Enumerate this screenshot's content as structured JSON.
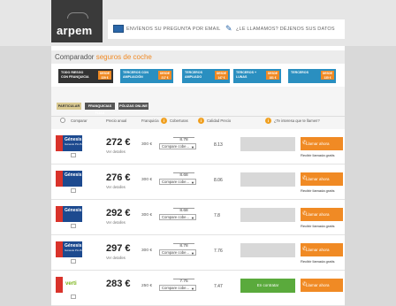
{
  "header": {
    "logo_text": "arpem",
    "contact_email_text": "ENVÍENOS SU PREGUNTA POR EMAIL",
    "callback_text": "¿LE LLAMAMOS? DÉJENOS SUS DATOS"
  },
  "breadcrumb": {
    "prefix": "Comparador",
    "highlight": "seguros de coche"
  },
  "coverage_tabs": [
    {
      "label": "TODO RIESGO CON FRANQUICIA",
      "price": "DESDE 229 €"
    },
    {
      "label": "TERCEROS CON AMPLIACIÓN",
      "price": "DESDE 217 €"
    },
    {
      "label": "TERCEROS AMPLIADO",
      "price": "DESDE 147 €"
    },
    {
      "label": "TERCEROS + LUNAS",
      "price": "DESDE 181 €"
    },
    {
      "label": "TERCEROS",
      "price": "DESDE 135 €"
    }
  ],
  "filter_tabs": [
    "PARTICULAR",
    "FRANQUICIAS FIJAS",
    "PÓLIZAS ONLINE"
  ],
  "table_headers": {
    "compare": "Comparar",
    "annual_price": "Precio anual",
    "franchise": "Franquicia",
    "coverage": "Coberturas",
    "quality": "Calidad Precio",
    "call": "¿Te interesa que te llamen?"
  },
  "rows": [
    {
      "insurer": "Génesis",
      "insurer_sub": "Génesis PLUS",
      "price": "272 €",
      "price_sub": "Ver detalles",
      "franchise": "300 €",
      "coverage_value": "8.78",
      "coverage_select": "Compare cobe...",
      "quality": "8.13",
      "cta": "Llamar ahora",
      "cta_sub": "Recibir llamada gratis",
      "verti": false,
      "green": false
    },
    {
      "insurer": "Génesis",
      "insurer_sub": "",
      "price": "276 €",
      "price_sub": "Ver detalles",
      "franchise": "300 €",
      "coverage_value": "8.68",
      "coverage_select": "Compare cobe...",
      "quality": "8.06",
      "cta": "Llamar ahora",
      "cta_sub": "Recibir llamada gratis",
      "verti": false,
      "green": false
    },
    {
      "insurer": "Génesis",
      "insurer_sub": "",
      "price": "292 €",
      "price_sub": "Ver detalles",
      "franchise": "300 €",
      "coverage_value": "8.68",
      "coverage_select": "Compare cobe...",
      "quality": "7.8",
      "cta": "Llamar ahora",
      "cta_sub": "Recibir llamada gratis",
      "verti": false,
      "green": false
    },
    {
      "insurer": "Génesis",
      "insurer_sub": "Génesis PLUS",
      "price": "297 €",
      "price_sub": "Ver detalles",
      "franchise": "300 €",
      "coverage_value": "8.78",
      "coverage_select": "Compare cobe...",
      "quality": "7.76",
      "cta": "Llamar ahora",
      "cta_sub": "Recibir llamada gratis",
      "verti": false,
      "green": false
    },
    {
      "insurer": "verti",
      "insurer_sub": "",
      "price": "283 €",
      "price_sub": "",
      "franchise": "250 €",
      "coverage_value": "7.75",
      "coverage_select": "Compare cobe...",
      "quality": "7.47",
      "cta": "Llamar ahora",
      "cta_sub": "",
      "verti": true,
      "green": true,
      "green_text": "En contratar"
    }
  ],
  "colors": {
    "accent": "#f08a24",
    "primary": "#2a8fc0",
    "dark": "#333333"
  }
}
